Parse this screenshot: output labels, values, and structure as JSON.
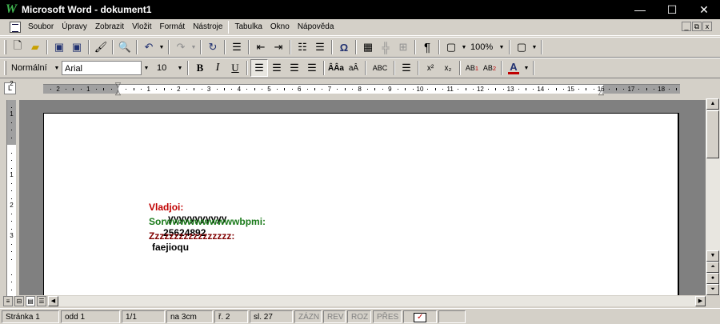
{
  "window": {
    "app_icon": "W",
    "title": "Microsoft Word - dokument1",
    "minimize": "—",
    "maximize": "☐",
    "close": "✕"
  },
  "menu": {
    "items": [
      "Soubor",
      "Úpravy",
      "Zobrazit",
      "Vložit",
      "Formát",
      "Nástroje",
      "Tabulka",
      "Okno",
      "Nápověda"
    ],
    "doc_controls": [
      "_",
      "⧉",
      "x"
    ]
  },
  "toolbar_standard": {
    "zoom": "100%"
  },
  "toolbar_format": {
    "style": "Normální",
    "font": "Arial",
    "size": "10",
    "bold": "B",
    "italic": "I",
    "underline": "U",
    "font_color_letter": "A"
  },
  "ruler": {
    "labels": [
      "2",
      "1",
      "1",
      "2",
      "3",
      "4",
      "5",
      "6",
      "7",
      "8",
      "9",
      "10",
      "11",
      "12",
      "13",
      "14",
      "15",
      "16",
      "17",
      "18"
    ],
    "tab_selector": "L"
  },
  "vruler": {
    "labels": [
      "2",
      "1",
      "1",
      "2",
      "3"
    ]
  },
  "document": {
    "lines": [
      {
        "label": "Vladjoi:",
        "value": "yyyyyyyyyyy"
      },
      {
        "label": "Sorwwwwwwwwwwbpmi:",
        "value": "25624892"
      },
      {
        "label": "Zzzzzzzzzzzzzzzzz:",
        "value": "faejioqu"
      }
    ],
    "colors": {
      "line1": "#c00000",
      "line2": "#1a7a1a",
      "line3": "#800000"
    }
  },
  "status": {
    "page": "Stránka  1",
    "section": "odd  1",
    "pages": "1/1",
    "at": "na  3cm",
    "line": "ř.  2",
    "col": "sl.  27",
    "rec": "ZÁZN",
    "rev": "REV",
    "ext": "ROZ",
    "ovr": "PŘES"
  }
}
